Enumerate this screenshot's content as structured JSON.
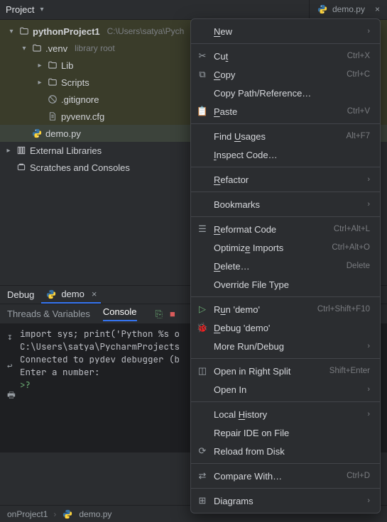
{
  "project": {
    "title": "Project"
  },
  "editor_tab": "demo.py",
  "tree": {
    "root": {
      "name": "pythonProject1",
      "path": "C:\\Users\\satya\\Pych"
    },
    "venv": {
      "name": ".venv",
      "hint": "library root"
    },
    "lib": "Lib",
    "scripts": "Scripts",
    "gitignore": ".gitignore",
    "pyvenv": "pyvenv.cfg",
    "demo": "demo.py",
    "ext_lib": "External Libraries",
    "scratches": "Scratches and Consoles"
  },
  "debug": {
    "label": "Debug",
    "tab": "demo",
    "threads_vars": "Threads & Variables",
    "console": "Console",
    "lines": [
      "import sys; print('Python %s o",
      "C:\\Users\\satya\\PycharmProjects",
      "Connected to pydev debugger (b",
      "Enter a number:"
    ],
    "prompt": ">?"
  },
  "breadcrumb": {
    "a": "onProject1",
    "b": "demo.py"
  },
  "ctx": {
    "new": "New",
    "cut": {
      "label": "Cut",
      "short": "Ctrl+X"
    },
    "copy": {
      "label": "Copy",
      "short": "Ctrl+C"
    },
    "copy_path": "Copy Path/Reference…",
    "paste": {
      "label": "Paste",
      "short": "Ctrl+V"
    },
    "find_usages": {
      "label": "Find Usages",
      "short": "Alt+F7"
    },
    "inspect": "Inspect Code…",
    "refactor": "Refactor",
    "bookmarks": "Bookmarks",
    "reformat": {
      "label": "Reformat Code",
      "short": "Ctrl+Alt+L"
    },
    "optimize": {
      "label": "Optimize Imports",
      "short": "Ctrl+Alt+O"
    },
    "delete": {
      "label": "Delete…",
      "short": "Delete"
    },
    "override": "Override File Type",
    "run": {
      "label": "Run 'demo'",
      "short": "Ctrl+Shift+F10"
    },
    "debug_i": "Debug 'demo'",
    "more_run": "More Run/Debug",
    "open_split": {
      "label": "Open in Right Split",
      "short": "Shift+Enter"
    },
    "open_in": "Open In",
    "local_hist": "Local History",
    "repair": "Repair IDE on File",
    "reload": "Reload from Disk",
    "compare": {
      "label": "Compare With…",
      "short": "Ctrl+D"
    },
    "diagrams": "Diagrams"
  }
}
